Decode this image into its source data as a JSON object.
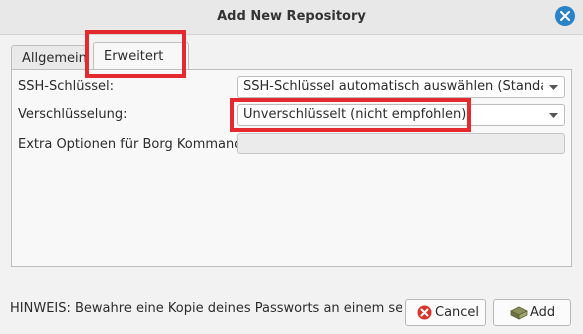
{
  "window": {
    "title": "Add New Repository"
  },
  "tabs": [
    {
      "label": "Allgemein"
    },
    {
      "label": "Erweitert"
    }
  ],
  "form": {
    "ssh_key": {
      "label": "SSH-Schlüssel:",
      "value": "SSH-Schlüssel automatisch auswählen (Standardeinstellung)"
    },
    "encryption": {
      "label": "Verschlüsselung:",
      "value": "Unverschlüsselt (nicht empfohlen)"
    },
    "extra_options": {
      "label": "Extra Optionen für Borg Kommando:",
      "value": ""
    }
  },
  "footer": {
    "note": "HINWEIS: Bewahre eine Kopie deines Passworts an einem separaten Ort auf.",
    "cancel_label": "Cancel",
    "add_label": "Add"
  },
  "colors": {
    "highlight": "#e52a2f",
    "accent": "#2b82c9"
  }
}
